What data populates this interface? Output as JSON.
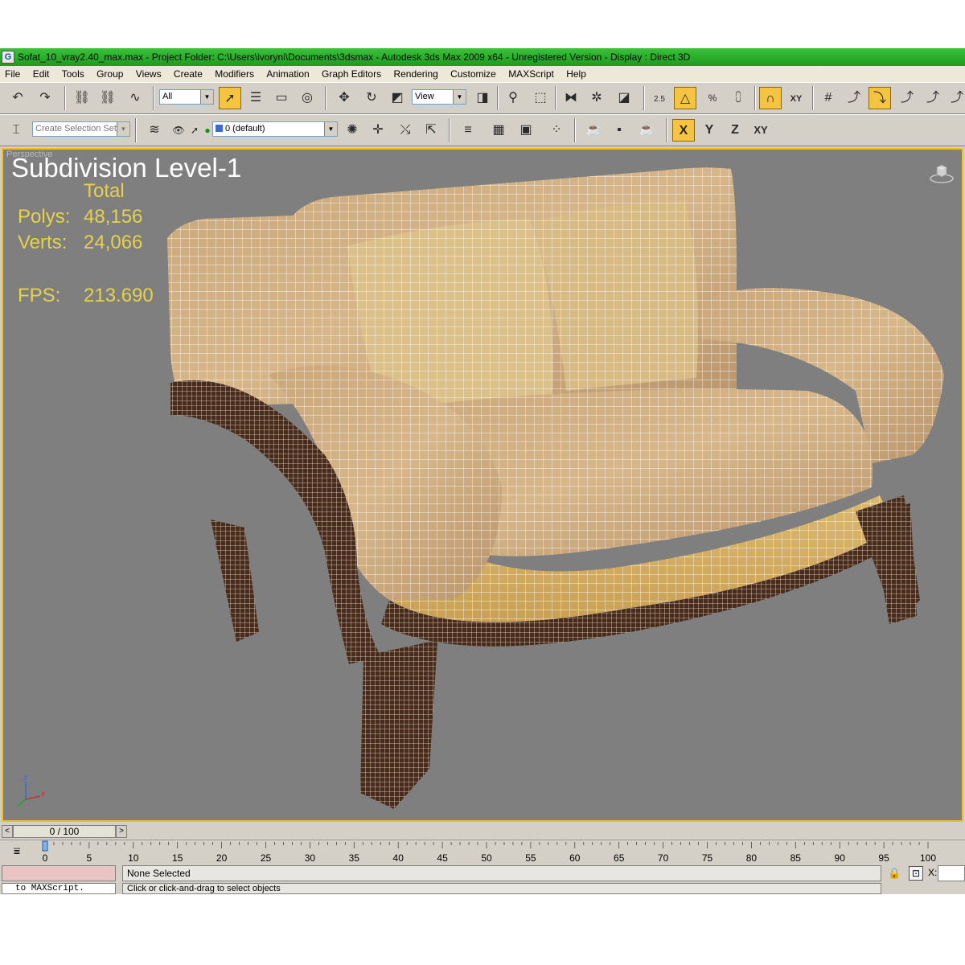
{
  "window": {
    "title": "Sofat_10_vray2.40_max.max      - Project Folder: C:\\Users\\ivoryni\\Documents\\3dsmax      - Autodesk 3ds Max  2009 x64  - Unregistered Version       - Display : Direct 3D",
    "app_icon_glyph": "G"
  },
  "menu": [
    "File",
    "Edit",
    "Tools",
    "Group",
    "Views",
    "Create",
    "Modifiers",
    "Animation",
    "Graph Editors",
    "Rendering",
    "Customize",
    "MAXScript",
    "Help"
  ],
  "toolbar1": {
    "selection_filter": "All",
    "reference_coord": "View",
    "snap_label": "2.5",
    "angle_snap_label": "%",
    "xy_label": "XY"
  },
  "toolbar2": {
    "named_selection_placeholder": "Create Selection Set",
    "layer_value": "0 (default)",
    "axis_labels": [
      "X",
      "Y",
      "Z",
      "XY"
    ]
  },
  "viewport": {
    "label": "Perspective",
    "overlay_title": "Subdivision Level-1",
    "stats_header": "Total",
    "polys_label": "Polys:",
    "polys_value": "48,156",
    "verts_label": "Verts:",
    "verts_value": "24,066",
    "fps_label": "FPS:",
    "fps_value": "213.690",
    "gizmo_z": "z",
    "gizmo_x": "x"
  },
  "time_slider": {
    "position_label": "0 / 100",
    "prev_glyph": "<",
    "next_glyph": ">"
  },
  "track_bar": {
    "ticks": [
      "0",
      "5",
      "10",
      "15",
      "20",
      "25",
      "30",
      "35",
      "40",
      "45",
      "50",
      "55",
      "60",
      "65",
      "70",
      "75",
      "80",
      "85",
      "90",
      "95",
      "100"
    ]
  },
  "status": {
    "maxscript_output": "to MAXScript.",
    "selection_status": "None Selected",
    "prompt": "Click or click-and-drag to select objects",
    "coord_x_label": "X:"
  },
  "colors": {
    "accent_active": "#f5c542",
    "viewport_bg": "#7f7f7f",
    "viewport_border": "#f0c020",
    "stats_text": "#e6d24a",
    "title_bar": "#2aae2a"
  }
}
